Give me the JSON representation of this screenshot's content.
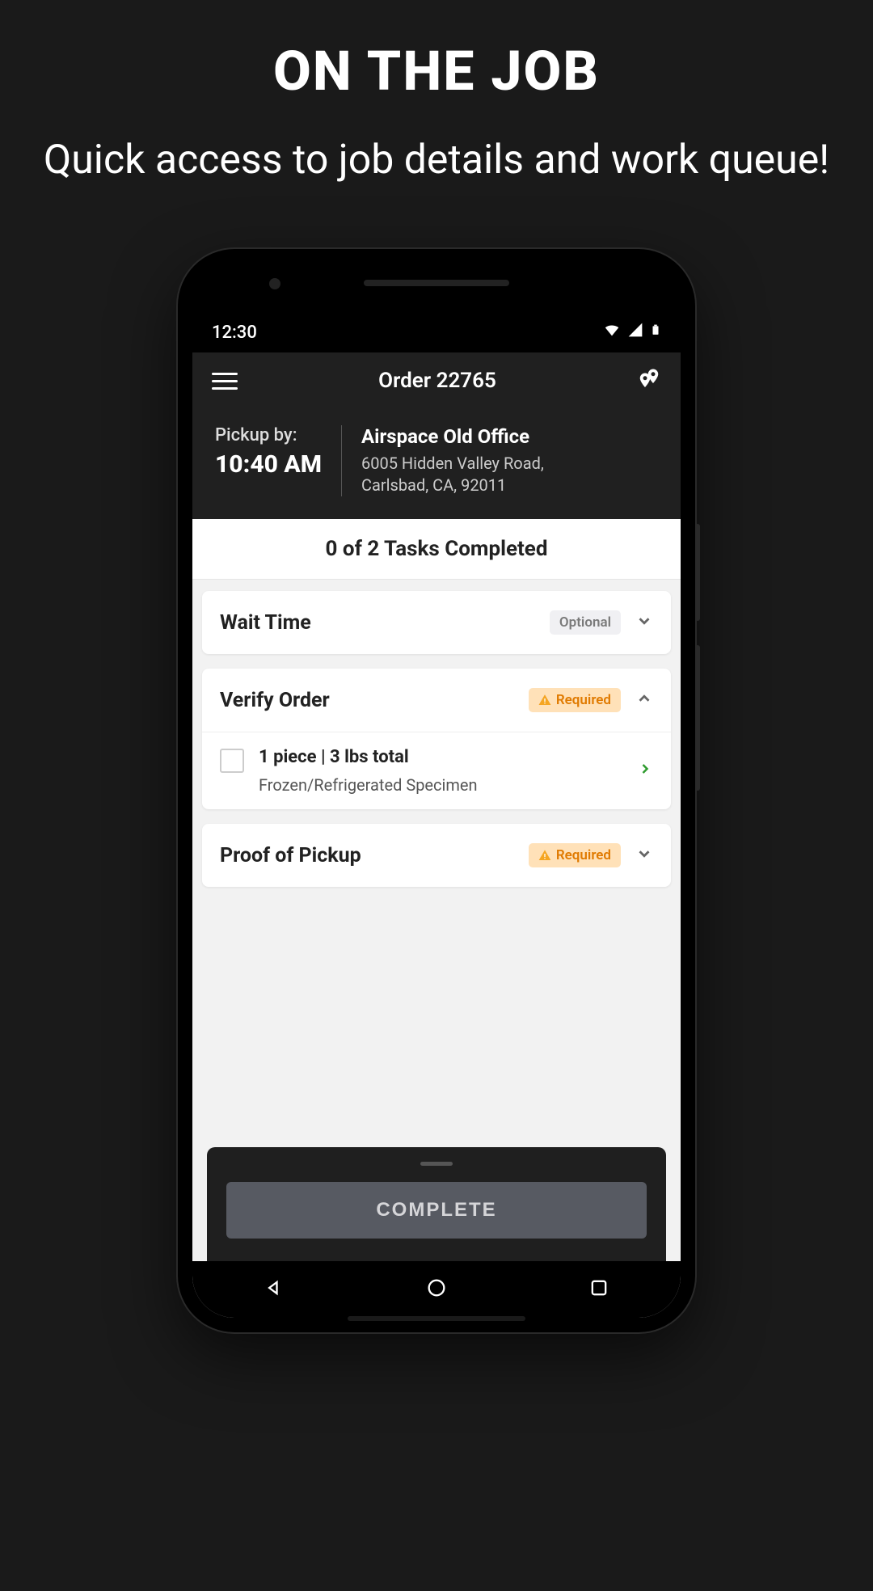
{
  "promo": {
    "title": "ON THE JOB",
    "subtitle": "Quick access to job details and work queue!"
  },
  "statusbar": {
    "time": "12:30"
  },
  "appbar": {
    "title": "Order 22765"
  },
  "pickup": {
    "label": "Pickup by:",
    "time": "10:40 AM",
    "location_name": "Airspace Old Office",
    "address_line1": "6005 Hidden Valley Road,",
    "address_line2": "Carlsbad, CA, 92011"
  },
  "tasks": {
    "summary": "0 of 2 Tasks Completed",
    "items": [
      {
        "title": "Wait Time",
        "tag": "Optional",
        "tag_type": "optional",
        "expanded": false
      },
      {
        "title": "Verify Order",
        "tag": "Required",
        "tag_type": "required",
        "expanded": true,
        "row": {
          "title": "1 piece | 3 lbs total",
          "subtitle": "Frozen/Refrigerated Specimen"
        }
      },
      {
        "title": "Proof of Pickup",
        "tag": "Required",
        "tag_type": "required",
        "expanded": false
      }
    ]
  },
  "footer": {
    "complete_label": "COMPLETE"
  }
}
